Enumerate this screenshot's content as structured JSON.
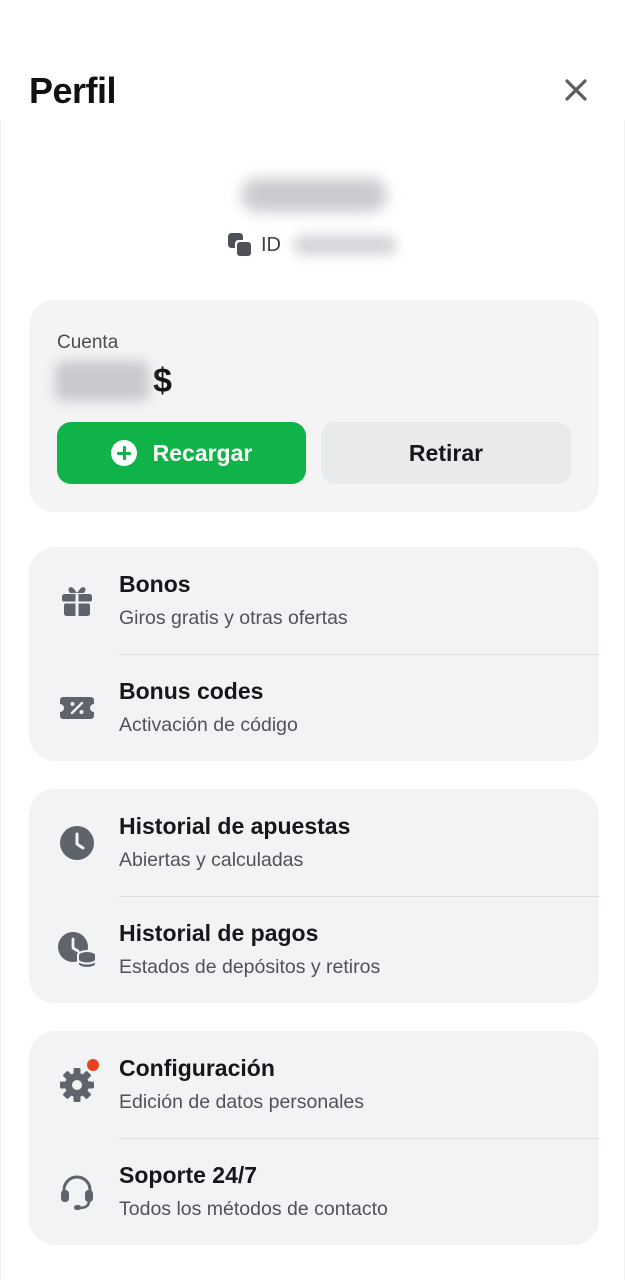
{
  "header": {
    "title": "Perfil"
  },
  "user": {
    "id_label": "ID"
  },
  "account": {
    "label": "Cuenta",
    "currency": "$",
    "recharge_label": "Recargar",
    "withdraw_label": "Retirar"
  },
  "groups": [
    {
      "items": [
        {
          "title": "Bonos",
          "subtitle": "Giros gratis y otras ofertas",
          "icon": "gift-icon"
        },
        {
          "title": "Bonus codes",
          "subtitle": "Activación de código",
          "icon": "promo-ticket-icon"
        }
      ]
    },
    {
      "items": [
        {
          "title": "Historial de apuestas",
          "subtitle": "Abiertas y calculadas",
          "icon": "clock-icon"
        },
        {
          "title": "Historial de pagos",
          "subtitle": "Estados de depósitos y retiros",
          "icon": "clock-coins-icon"
        }
      ]
    },
    {
      "items": [
        {
          "title": "Configuración",
          "subtitle": "Edición de datos personales",
          "icon": "gear-icon",
          "notification_dot": true
        },
        {
          "title": "Soporte 24/7",
          "subtitle": "Todos los métodos de contacto",
          "icon": "headset-icon"
        }
      ]
    }
  ],
  "colors": {
    "accent_green": "#10b347",
    "card_bg": "#f2f3f5",
    "icon_gray": "#5f636b",
    "notification_red": "#e8411c"
  }
}
